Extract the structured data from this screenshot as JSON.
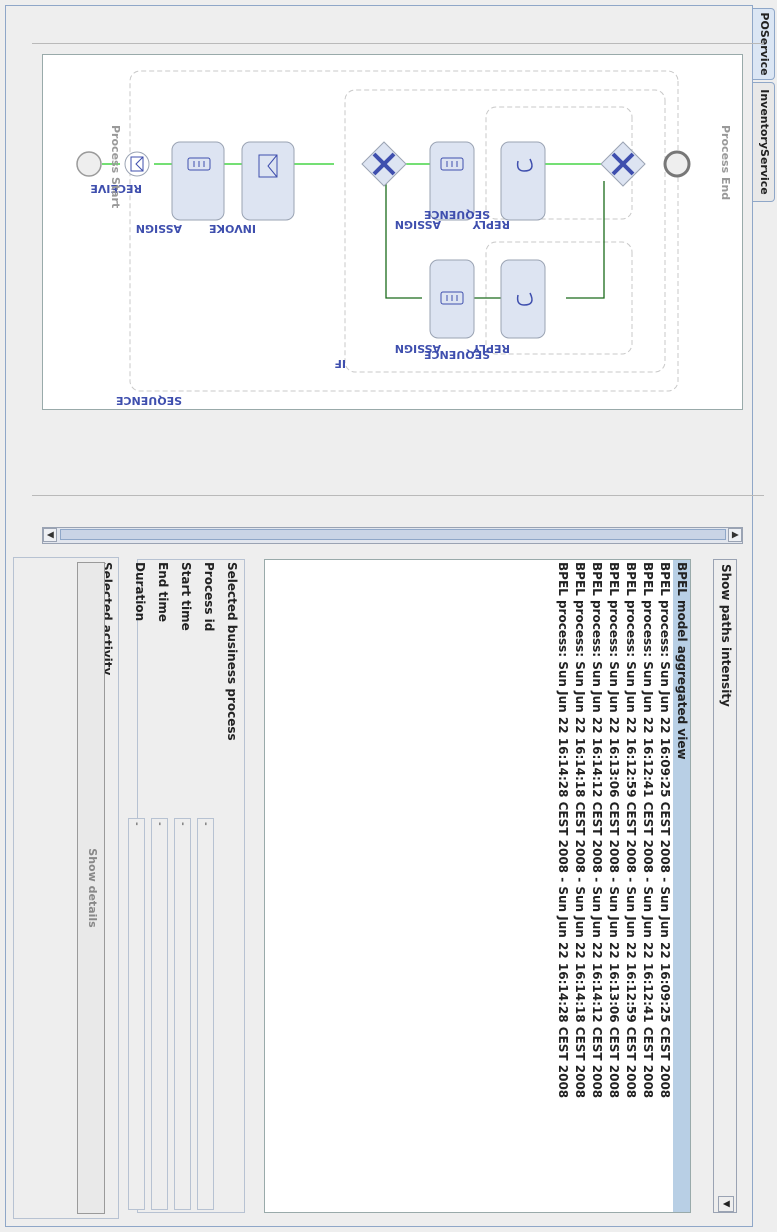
{
  "tabs": [
    {
      "label": "POService",
      "active": true
    },
    {
      "label": "InventoryService",
      "active": false
    }
  ],
  "diagram": {
    "start_label": "Process Start",
    "end_label": "Process End",
    "outer_sequence_label": "SEQUENCE",
    "receive_label": "RECEIVE",
    "assign_label": "ASSIGN",
    "invoke_label": "INVOKE",
    "if_label": "IF",
    "branch1": {
      "sequence_label": "SEQUENCE",
      "assign_label": "ASSIGN",
      "reply_label": "REPLY"
    },
    "branch2": {
      "sequence_label": "SEQUENCE",
      "assign_label": "ASSIGN",
      "reply_label": "REPLY"
    },
    "colors": {
      "flow_green": "#22cc22",
      "dark_green": "#1a6b1a",
      "activity_blue": "#3f4fae",
      "label_grey": "#999999"
    }
  },
  "show_paths_label": "Show paths intensity",
  "process_list": {
    "items": [
      "BPEL model aggregated view",
      "BPEL process: Sun Jun 22 16:09:25 CEST 2008 - Sun Jun 22 16:09:25 CEST 2008",
      "BPEL process: Sun Jun 22 16:12:41 CEST 2008 - Sun Jun 22 16:12:41 CEST 2008",
      "BPEL process: Sun Jun 22 16:12:59 CEST 2008 - Sun Jun 22 16:12:59 CEST 2008",
      "BPEL process: Sun Jun 22 16:13:06 CEST 2008 - Sun Jun 22 16:13:06 CEST 2008",
      "BPEL process: Sun Jun 22 16:14:12 CEST 2008 - Sun Jun 22 16:14:12 CEST 2008",
      "BPEL process: Sun Jun 22 16:14:18 CEST 2008 - Sun Jun 22 16:14:18 CEST 2008",
      "BPEL process: Sun Jun 22 16:14:28 CEST 2008 - Sun Jun 22 16:14:28 CEST 2008"
    ],
    "selected_index": 0
  },
  "business_process": {
    "title": "Selected business process",
    "fields": [
      {
        "label": "Process id",
        "value": "-"
      },
      {
        "label": "Start time",
        "value": "-"
      },
      {
        "label": "End time",
        "value": "-"
      },
      {
        "label": "Duration",
        "value": "-"
      }
    ]
  },
  "activity": {
    "title": "Selected activity",
    "button_label": "Show details"
  }
}
